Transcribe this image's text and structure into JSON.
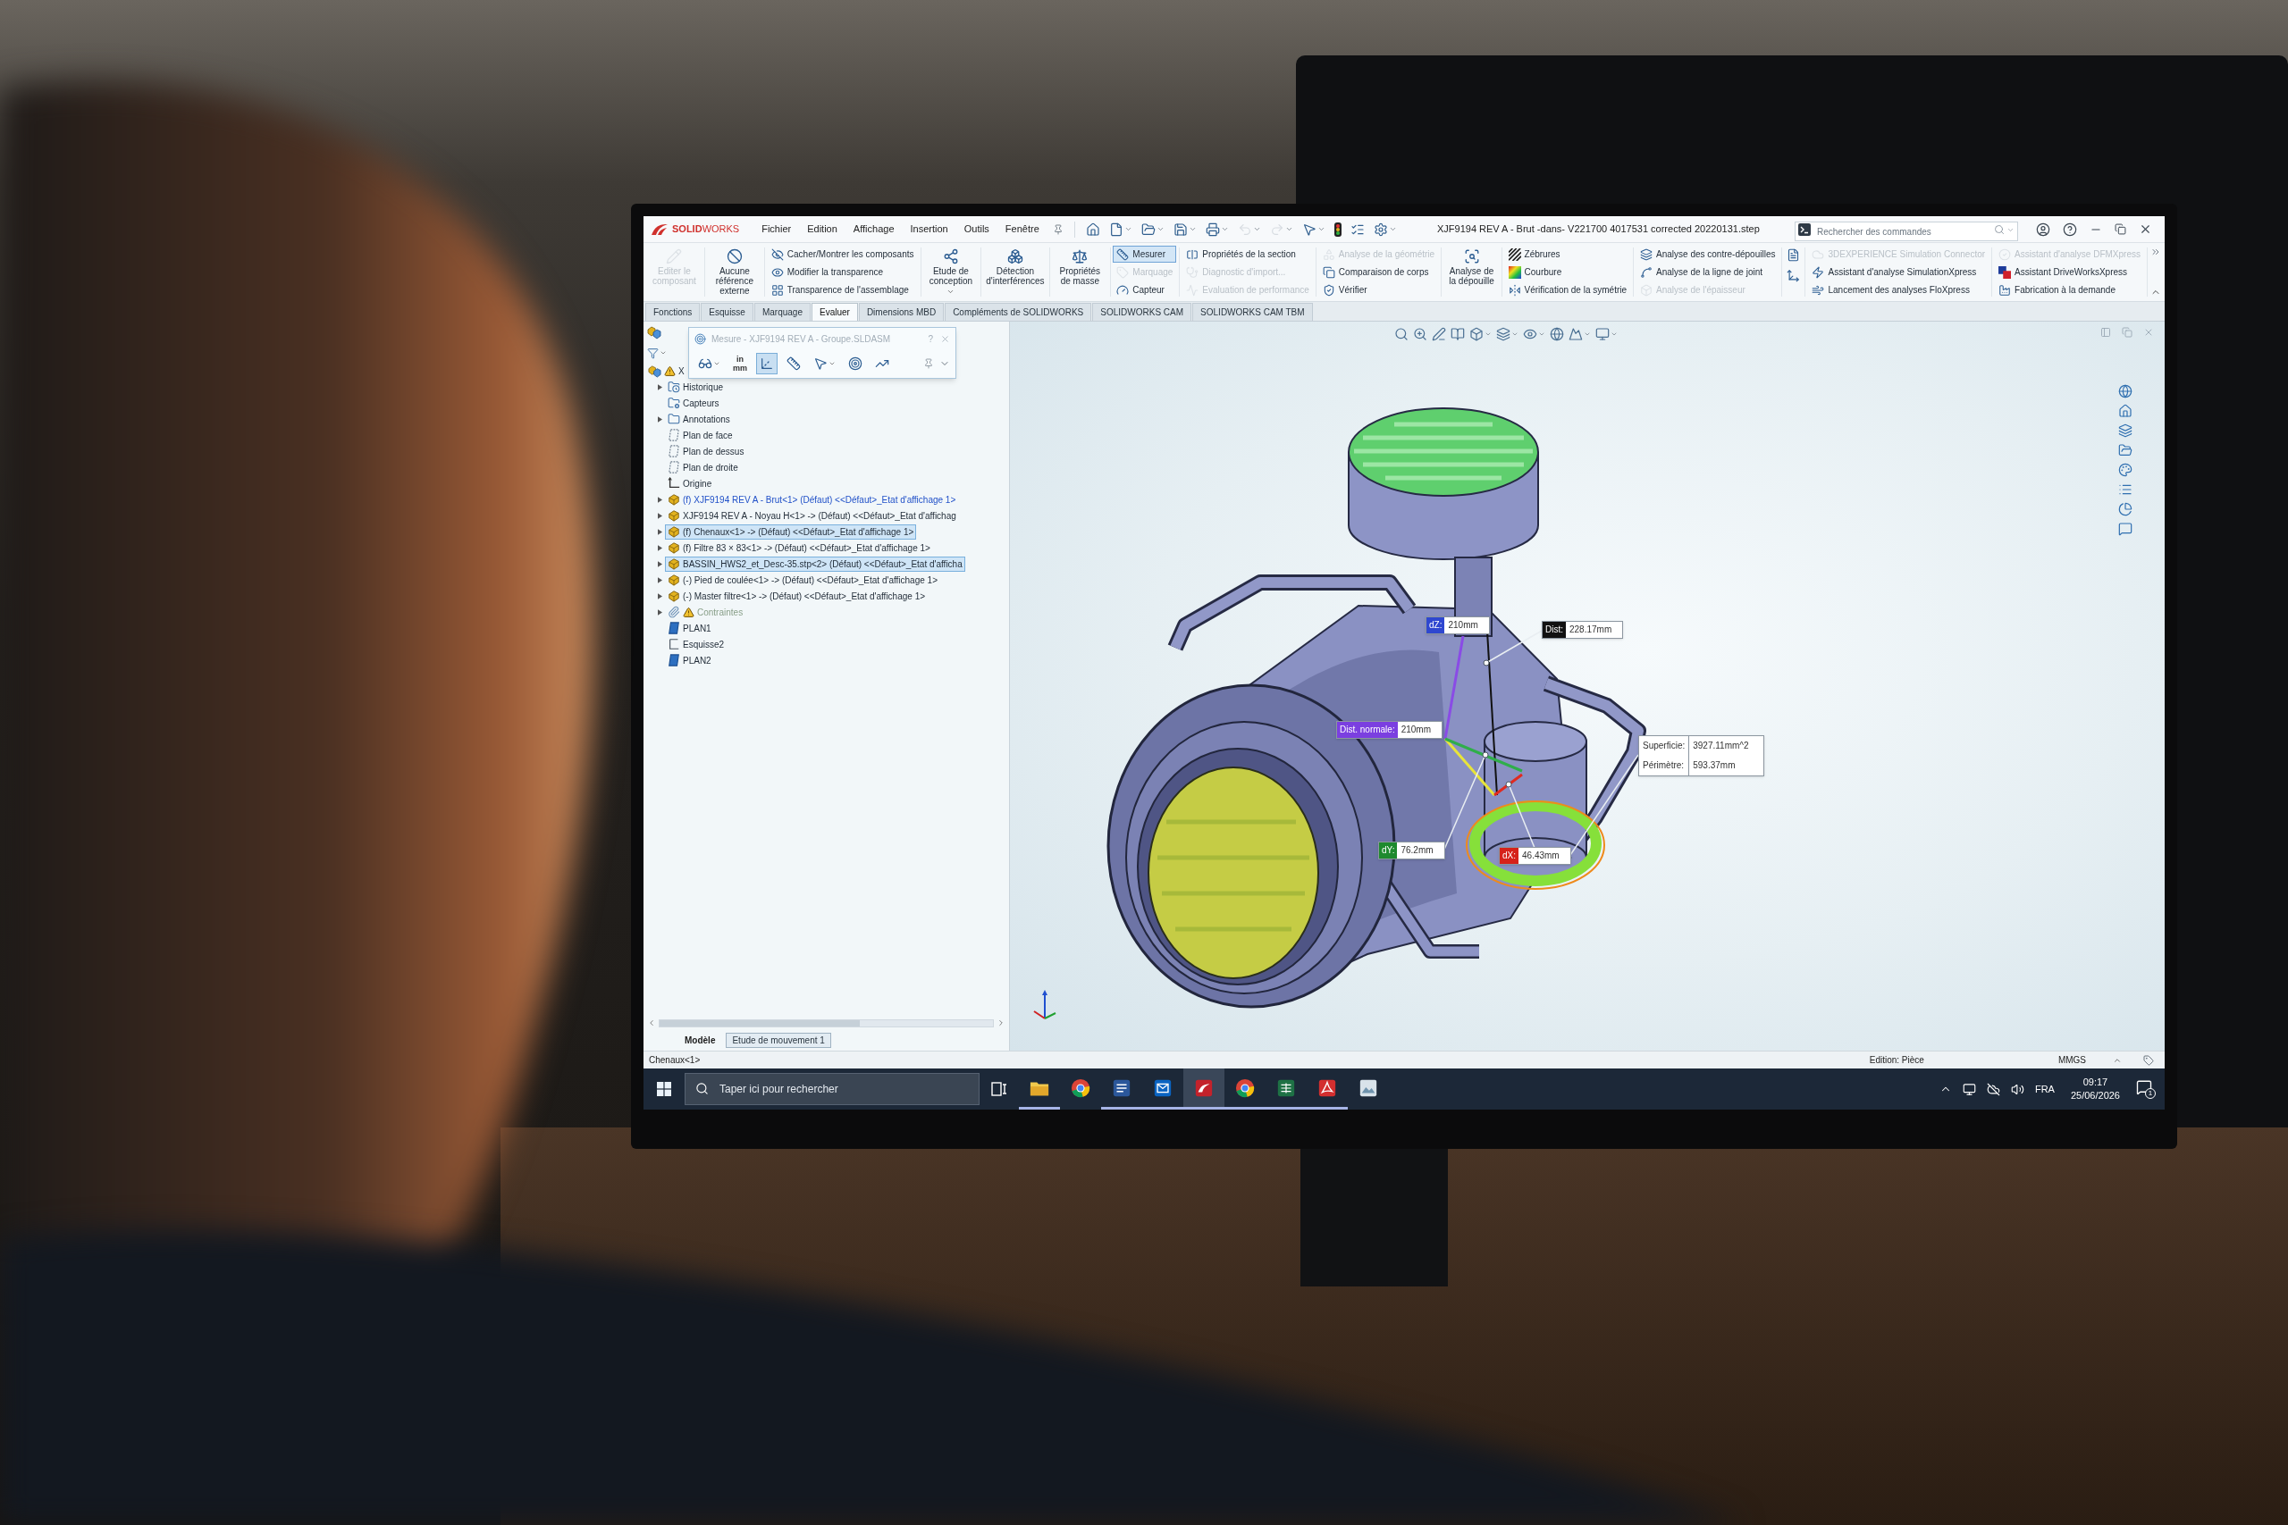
{
  "window": {
    "logo": "**SOLID**WORKS",
    "title": "XJF9194 REV A - Brut -dans- V221700 4017531 corrected 20220131.step"
  },
  "menu": [
    "Fichier",
    "Edition",
    "Affichage",
    "Insertion",
    "Outils",
    "Fenêtre"
  ],
  "quick_access": [
    {
      "disabled": false
    },
    {
      "disabled": false
    },
    {
      "disabled": false
    },
    {
      "disabled": false
    },
    {
      "disabled": false
    },
    {
      "disabled": true
    },
    {
      "disabled": true
    },
    {
      "disabled": false
    },
    {
      "disabled": false
    },
    {
      "disabled": false
    },
    {
      "disabled": false
    }
  ],
  "command_search": {
    "placeholder": "Rechercher des commandes"
  },
  "ribbon": {
    "groups": [
      {
        "kind": "large",
        "label": "Editer le composant",
        "disabled": true,
        "active": false,
        "dropdown": false
      },
      {
        "kind": "large",
        "label": "Aucune référence externe",
        "disabled": false,
        "active": false,
        "dropdown": false
      },
      {
        "kind": "column",
        "items": [
          {
            "label": "Cacher/Montrer les composants",
            "disabled": false,
            "active": false
          },
          {
            "label": "Modifier la transparence",
            "disabled": false,
            "active": false
          },
          {
            "label": "Transparence de l'assemblage",
            "disabled": false,
            "active": false
          }
        ]
      },
      {
        "kind": "large",
        "label": "Etude de conception",
        "disabled": false,
        "active": false,
        "dropdown": true
      },
      {
        "kind": "large",
        "label": "Détection d'interférences",
        "disabled": false,
        "active": false,
        "dropdown": false
      },
      {
        "kind": "large",
        "label": "Propriétés de masse",
        "disabled": false,
        "active": false,
        "dropdown": false
      },
      {
        "kind": "column",
        "items": [
          {
            "label": "Mesurer",
            "disabled": false,
            "active": true
          },
          {
            "label": "Marquage",
            "disabled": true,
            "active": false
          },
          {
            "label": "Capteur",
            "disabled": false,
            "active": false
          }
        ]
      },
      {
        "kind": "column",
        "items": [
          {
            "label": "Propriétés de la section",
            "disabled": false,
            "active": false
          },
          {
            "label": "Diagnostic d'import...",
            "disabled": true,
            "active": false
          },
          {
            "label": "Evaluation de performance",
            "disabled": true,
            "active": false
          }
        ]
      },
      {
        "kind": "column",
        "items": [
          {
            "label": "Analyse de la géométrie",
            "disabled": true,
            "active": false
          },
          {
            "label": "Comparaison de corps",
            "disabled": false,
            "active": false
          },
          {
            "label": "Vérifier",
            "disabled": false,
            "active": false
          }
        ]
      },
      {
        "kind": "large",
        "label": "Analyse de la dépouille",
        "disabled": false,
        "active": false,
        "dropdown": false
      },
      {
        "kind": "column",
        "items": [
          {
            "label": "Zébrures",
            "disabled": false,
            "active": false
          },
          {
            "label": "Courbure",
            "disabled": false,
            "active": false
          },
          {
            "label": "Vérification de la symétrie",
            "disabled": false,
            "active": false
          }
        ]
      },
      {
        "kind": "column",
        "items": [
          {
            "label": "Analyse des contre-dépouilles",
            "disabled": false,
            "active": false
          },
          {
            "label": "Analyse de la ligne de joint",
            "disabled": false,
            "active": false
          },
          {
            "label": "Analyse de l'épaisseur",
            "disabled": true,
            "active": false
          }
        ]
      },
      {
        "kind": "icon_column"
      },
      {
        "kind": "column",
        "items": [
          {
            "label": "3DEXPERIENCE Simulation Connector",
            "disabled": true,
            "active": false
          },
          {
            "label": "Assistant d'analyse SimulationXpress",
            "disabled": false,
            "active": false
          },
          {
            "label": "Lancement des analyses FloXpress",
            "disabled": false,
            "active": false
          }
        ]
      },
      {
        "kind": "column",
        "items": [
          {
            "label": "Assistant d'analyse DFMXpress",
            "disabled": true,
            "active": false
          },
          {
            "label": "Assistant DriveWorksXpress",
            "disabled": false,
            "active": false
          },
          {
            "label": "Fabrication à la demande",
            "disabled": false,
            "active": false
          }
        ]
      }
    ]
  },
  "tabs": [
    {
      "label": "Fonctions",
      "selected": false
    },
    {
      "label": "Esquisse",
      "selected": false
    },
    {
      "label": "Marquage",
      "selected": false
    },
    {
      "label": "Evaluer",
      "selected": true
    },
    {
      "label": "Dimensions MBD",
      "selected": false
    },
    {
      "label": "Compléments de SOLIDWORKS",
      "selected": false
    },
    {
      "label": "SOLIDWORKS CAM",
      "selected": false
    },
    {
      "label": "SOLIDWORKS CAM TBM",
      "selected": false
    }
  ],
  "feature_manager": {
    "root": {
      "label": "X",
      "warning": true,
      "children": [
        {
          "label": "Historique",
          "kind": "history",
          "expandable": true,
          "selected": false,
          "editing": false,
          "dimmed": false,
          "warning": false
        },
        {
          "label": "Capteurs",
          "kind": "sensors",
          "expandable": false,
          "selected": false,
          "editing": false,
          "dimmed": false,
          "warning": false
        },
        {
          "label": "Annotations",
          "kind": "annotations",
          "expandable": true,
          "selected": false,
          "editing": false,
          "dimmed": false,
          "warning": false
        },
        {
          "label": "Plan de face",
          "kind": "plane",
          "expandable": false,
          "selected": false,
          "editing": false,
          "dimmed": false,
          "warning": false
        },
        {
          "label": "Plan de dessus",
          "kind": "plane",
          "expandable": false,
          "selected": false,
          "editing": false,
          "dimmed": false,
          "warning": false
        },
        {
          "label": "Plan de droite",
          "kind": "plane",
          "expandable": false,
          "selected": false,
          "editing": false,
          "dimmed": false,
          "warning": false
        },
        {
          "label": "Origine",
          "kind": "origin",
          "expandable": false,
          "selected": false,
          "editing": false,
          "dimmed": false,
          "warning": false
        },
        {
          "label": "(f) XJF9194 REV A - Brut<1> (Défaut) <<Défaut>_Etat d'affichage 1>",
          "kind": "part",
          "expandable": true,
          "selected": false,
          "editing": true,
          "dimmed": false,
          "warning": false
        },
        {
          "label": "XJF9194 REV A - Noyau H<1> -> (Défaut) <<Défaut>_Etat d'affichag",
          "kind": "part",
          "expandable": true,
          "selected": false,
          "editing": false,
          "dimmed": false,
          "warning": false
        },
        {
          "label": "(f) Chenaux<1> -> (Défaut) <<Défaut>_Etat d'affichage 1>",
          "kind": "part",
          "expandable": true,
          "selected": true,
          "editing": false,
          "dimmed": false,
          "warning": false
        },
        {
          "label": "(f) Filtre 83 × 83<1> -> (Défaut) <<Défaut>_Etat d'affichage 1>",
          "kind": "part",
          "expandable": true,
          "selected": false,
          "editing": false,
          "dimmed": false,
          "warning": false
        },
        {
          "label": "BASSIN_HWS2_et_Desc-35.stp<2> (Défaut) <<Défaut>_Etat d'afficha",
          "kind": "part",
          "expandable": true,
          "selected": true,
          "editing": false,
          "dimmed": false,
          "warning": false
        },
        {
          "label": "(-) Pied de coulée<1> -> (Défaut) <<Défaut>_Etat d'affichage 1>",
          "kind": "part",
          "expandable": true,
          "selected": false,
          "editing": false,
          "dimmed": false,
          "warning": false
        },
        {
          "label": "(-) Master filtre<1> -> (Défaut) <<Défaut>_Etat d'affichage 1>",
          "kind": "part",
          "expandable": true,
          "selected": false,
          "editing": false,
          "dimmed": false,
          "warning": false
        },
        {
          "label": "Contraintes",
          "kind": "constraints",
          "expandable": true,
          "selected": false,
          "editing": false,
          "dimmed": true,
          "warning": true
        },
        {
          "label": "PLAN1",
          "kind": "ref_plane",
          "expandable": false,
          "selected": false,
          "editing": false,
          "dimmed": false,
          "warning": false
        },
        {
          "label": "Esquisse2",
          "kind": "sketch",
          "expandable": false,
          "selected": false,
          "editing": false,
          "dimmed": false,
          "warning": false
        },
        {
          "label": "PLAN2",
          "kind": "ref_plane",
          "expandable": false,
          "selected": false,
          "editing": false,
          "dimmed": false,
          "warning": false
        }
      ]
    }
  },
  "measure_dialog": {
    "title": "Mesure - XJF9194 REV A - Groupe.SLDASM",
    "dimmed": true,
    "help": "?",
    "tools": [
      {
        "selected": false
      },
      {
        "selected": false,
        "units": [
          "in",
          "mm"
        ]
      },
      {
        "selected": true
      },
      {
        "selected": false
      },
      {
        "selected": false
      },
      {
        "selected": false
      },
      {
        "selected": false
      }
    ]
  },
  "bottom_tabs": [
    {
      "label": "Modèle",
      "selected": true
    },
    {
      "label": "Etude de mouvement 1",
      "selected": false
    }
  ],
  "measurements": [
    {
      "kind": "tag",
      "label": "dZ:",
      "value": "210mm",
      "color": "#2f47d0"
    },
    {
      "kind": "tag",
      "label": "Dist:",
      "value": "228.17mm",
      "color": "#111111"
    },
    {
      "kind": "tag",
      "label": "Dist. normale:",
      "value": "210mm",
      "color": "#7b3fe0"
    },
    {
      "kind": "table",
      "rows": [
        {
          "label": "Superficie:",
          "value": "3927.11mm^2"
        },
        {
          "label": "Périmètre:",
          "value": "593.37mm"
        }
      ]
    },
    {
      "kind": "tag",
      "label": "dY:",
      "value": "76.2mm",
      "color": "#1e8a2e"
    },
    {
      "kind": "tag",
      "label": "dX:",
      "value": "46.43mm",
      "color": "#d6221a"
    }
  ],
  "status_bar": {
    "selection": "Chenaux<1>",
    "mode": "Edition: Pièce",
    "units": "MMGS"
  },
  "taskbar": {
    "search_placeholder": "Taper ici pour rechercher",
    "apps": [
      {
        "running": true,
        "active": false
      },
      {
        "running": false,
        "active": false
      },
      {
        "running": true,
        "active": false
      },
      {
        "running": true,
        "active": false
      },
      {
        "running": true,
        "active": true
      },
      {
        "running": true,
        "active": false
      },
      {
        "running": true,
        "active": false
      },
      {
        "running": true,
        "active": false
      },
      {
        "running": false,
        "active": false
      }
    ],
    "language": "FRA",
    "time": "09:17",
    "date": "25/06/2026",
    "notifications": "1"
  }
}
